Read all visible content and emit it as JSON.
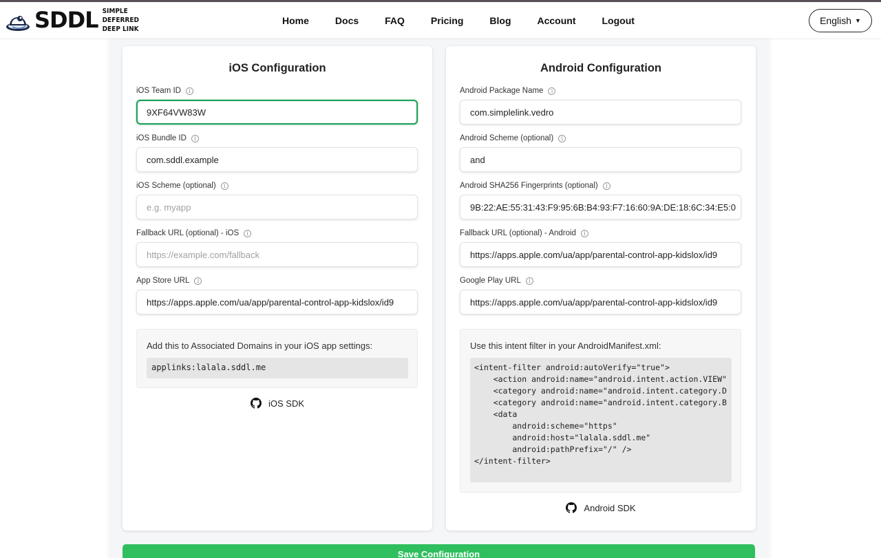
{
  "brand": {
    "name": "SDDL",
    "tagline_line1": "SIMPLE DEFERRED",
    "tagline_line2": "DEEP LINK"
  },
  "nav": [
    "Home",
    "Docs",
    "FAQ",
    "Pricing",
    "Blog",
    "Account",
    "Logout"
  ],
  "language": {
    "selected": "English"
  },
  "ios": {
    "title": "iOS Configuration",
    "team_id": {
      "label": "iOS Team ID",
      "value": "9XF64VW83W"
    },
    "bundle_id": {
      "label": "iOS Bundle ID",
      "value": "com.sddl.example"
    },
    "scheme": {
      "label": "iOS Scheme (optional)",
      "placeholder": "e.g. myapp"
    },
    "fallback": {
      "label": "Fallback URL (optional) - iOS",
      "placeholder": "https://example.com/fallback"
    },
    "app_store": {
      "label": "App Store URL",
      "value": "https://apps.apple.com/ua/app/parental-control-app-kidslox/id9"
    },
    "assoc_title": "Add this to Associated Domains in your iOS app settings:",
    "assoc_code": "applinks:lalala.sddl.me",
    "sdk_label": "iOS SDK"
  },
  "android": {
    "title": "Android Configuration",
    "package": {
      "label": "Android Package Name",
      "value": "com.simplelink.vedro"
    },
    "scheme": {
      "label": "Android Scheme (optional)",
      "value": "and"
    },
    "sha256": {
      "label": "Android SHA256 Fingerprints (optional)",
      "value": "9B:22:AE:55:31:43:F9:95:6B:B4:93:F7:16:60:9A:DE:18:6C:34:E5:0"
    },
    "fallback": {
      "label": "Fallback URL (optional) - Android",
      "value": "https://apps.apple.com/ua/app/parental-control-app-kidslox/id9"
    },
    "play": {
      "label": "Google Play URL",
      "value": "https://apps.apple.com/ua/app/parental-control-app-kidslox/id9"
    },
    "manifest_title": "Use this intent filter in your AndroidManifest.xml:",
    "manifest_code": "<intent-filter android:autoVerify=\"true\">\n    <action android:name=\"android.intent.action.VIEW\"\n    <category android:name=\"android.intent.category.D\n    <category android:name=\"android.intent.category.B\n    <data\n        android:scheme=\"https\"\n        android:host=\"lalala.sddl.me\"\n        android:pathPrefix=\"/\" />\n</intent-filter>",
    "sdk_label": "Android SDK"
  },
  "save_label": "Save Configuration",
  "colors": {
    "accent": "#2fbf5e",
    "focus": "#20a15b"
  }
}
